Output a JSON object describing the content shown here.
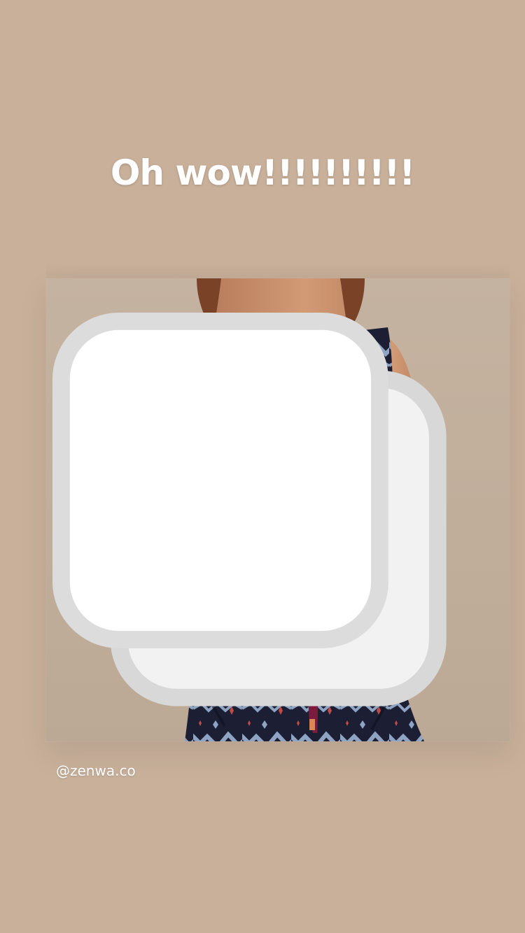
{
  "story": {
    "caption": "Oh wow!!!!!!!!!!",
    "mention": "@zenwa.co"
  },
  "post": {
    "media_type": "carousel",
    "subject": "v-neck ikat print crop top with matching drawstring pants",
    "icon": "multiple-photos-icon"
  },
  "colors": {
    "background": "#c8b09a",
    "card_background": "#c6b4a2",
    "fabric_navy": "#1c1f33",
    "fabric_pattern": "#8fa3c2",
    "accent_red": "#c14a45",
    "drawstring": "#7c1c3d",
    "skin": "#c9926e",
    "hair": "#7a4328",
    "text": "#ffffff"
  }
}
